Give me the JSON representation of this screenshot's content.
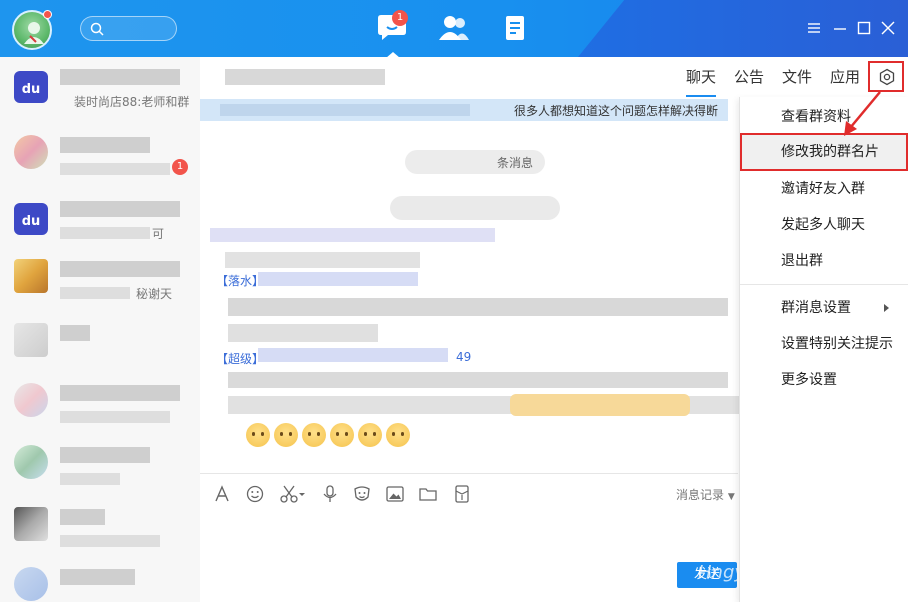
{
  "titlebar": {
    "nav_badge": "1",
    "icons": [
      "chat-icon",
      "contacts-icon",
      "apps-icon"
    ],
    "window_controls": [
      "menu-icon",
      "minimize-icon",
      "maximize-icon",
      "close-icon"
    ]
  },
  "sidebar": {
    "items": [
      {
        "sub": "装时尚店88:老师和群",
        "avatar": "du"
      },
      {
        "sub": "",
        "badge": "1"
      },
      {
        "sub": "可",
        "avatar": "du"
      },
      {
        "sub": "秘谢天"
      },
      {
        "sub": ""
      },
      {
        "sub": ""
      },
      {
        "sub": ""
      },
      {
        "sub": ""
      },
      {
        "sub": ""
      }
    ]
  },
  "chat": {
    "tabs": [
      "聊天",
      "公告",
      "文件",
      "应用"
    ],
    "active_tab": "聊天",
    "notice_text": "很多人都想知道这个问题怎样解决得断",
    "pill_text": "条消息",
    "sender_1": "【落水】",
    "sender_2": "【超级】",
    "sender_2_suffix": "49",
    "history_label": "消息记录",
    "send_label": "发送",
    "watermark": "Hngy"
  },
  "menu": {
    "items": [
      "查看群资料",
      "修改我的群名片",
      "邀请好友入群",
      "发起多人聊天",
      "退出群",
      "群消息设置",
      "设置特别关注提示",
      "更多设置"
    ],
    "highlighted_index": 1
  },
  "colors": {
    "titlebar": "#1890ef",
    "accent": "#1a8cf0",
    "highlight_border": "#e02c2c",
    "badge": "#f2544b"
  }
}
